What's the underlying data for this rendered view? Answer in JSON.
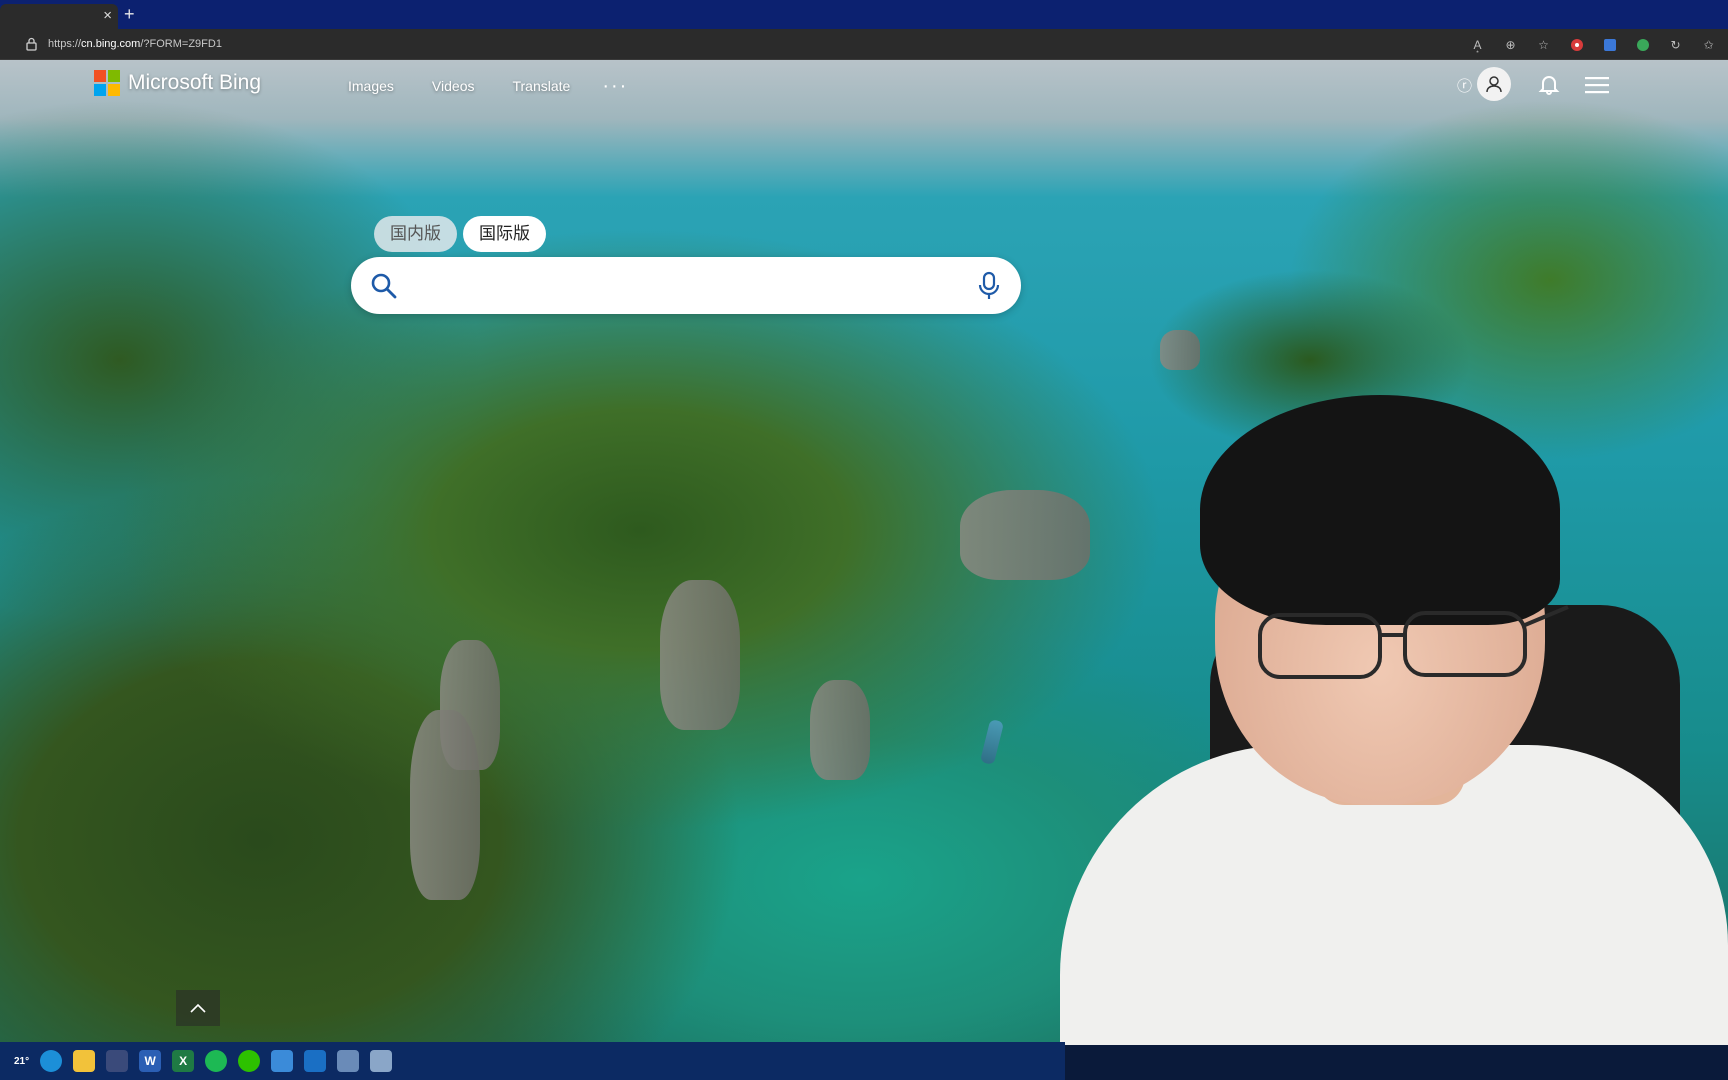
{
  "browser": {
    "tab_close_glyph": "×",
    "new_tab_glyph": "+",
    "url_prefix": "https://",
    "url_host": "cn.bing.com",
    "url_path": "/?FORM=Z9FD1",
    "toolbar_icons": [
      "read-aloud-icon",
      "zoom-icon",
      "add-favorite-icon",
      "extension-icon",
      "translate-icon",
      "extension-green-icon",
      "refresh-icon",
      "favorites-icon"
    ]
  },
  "bing": {
    "brand": "Microsoft Bing",
    "nav": {
      "images": "Images",
      "videos": "Videos",
      "translate": "Translate",
      "more": "···"
    },
    "rewards_glyph": "ⓡ",
    "region_tabs": {
      "domestic": "国内版",
      "international": "国际版"
    },
    "active_region": "international",
    "search": {
      "value": "",
      "placeholder": ""
    }
  },
  "taskbar": {
    "weather_badge": "21°",
    "apps": [
      "weather-icon",
      "edge-icon",
      "file-explorer-icon",
      "pen-icon",
      "word-icon",
      "excel-icon",
      "spotify-icon",
      "wechat-icon",
      "app-icon",
      "mail-icon",
      "app2-icon",
      "app3-icon"
    ]
  },
  "colors": {
    "tabstrip": "#0c2170",
    "taskbar": "#0c2a63",
    "ms_red": "#f25022",
    "ms_green": "#7fba00",
    "ms_blue": "#00a4ef",
    "ms_yellow": "#ffb900"
  }
}
